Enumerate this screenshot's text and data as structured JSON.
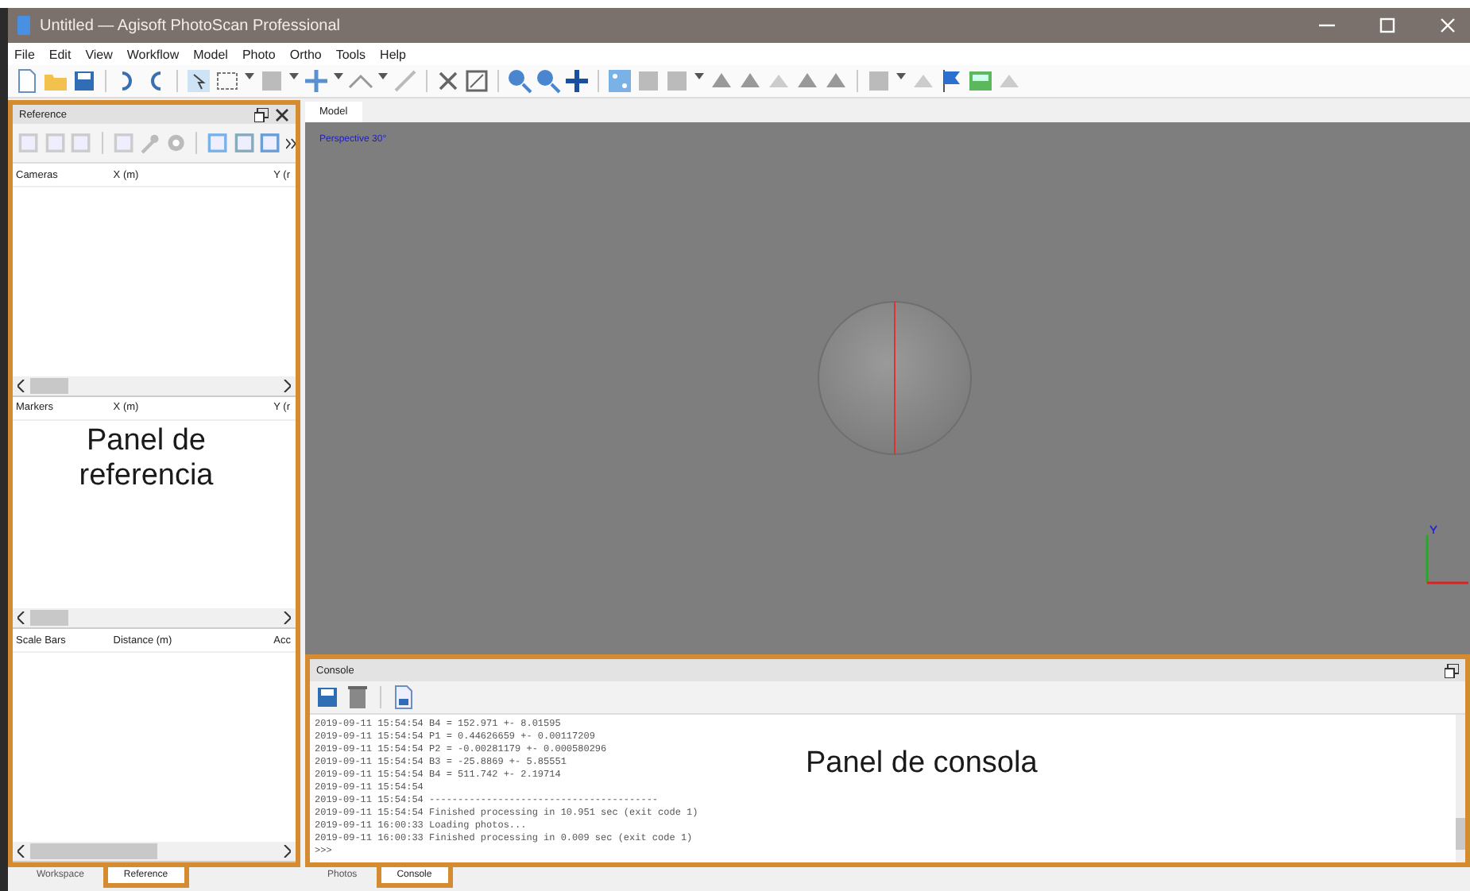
{
  "window": {
    "title": "Untitled — Agisoft PhotoScan Professional"
  },
  "menu": [
    "File",
    "Edit",
    "View",
    "Workflow",
    "Model",
    "Photo",
    "Ortho",
    "Tools",
    "Help"
  ],
  "reference_panel": {
    "title": "Reference",
    "sections": [
      {
        "columns": [
          "Cameras",
          "X (m)",
          "Y (r"
        ]
      },
      {
        "columns": [
          "Markers",
          "X (m)",
          "Y (r"
        ]
      },
      {
        "columns": [
          "Scale Bars",
          "Distance (m)",
          "Acc"
        ]
      }
    ]
  },
  "left_tabs": [
    {
      "label": "Workspace",
      "selected": false
    },
    {
      "label": "Reference",
      "selected": true
    }
  ],
  "viewport": {
    "tab": "Model",
    "label": "Perspective 30°"
  },
  "console": {
    "title": "Console",
    "lines": [
      "2019-09-11 15:54:54 B4 = 152.971 +- 8.01595",
      "2019-09-11 15:54:54 P1 = 0.44626659 +- 0.00117209",
      "2019-09-11 15:54:54 P2 = -0.00281179 +- 0.000580296",
      "2019-09-11 15:54:54 B3 = -25.8869 +- 5.85551",
      "2019-09-11 15:54:54 B4 = 511.742 +- 2.19714",
      "2019-09-11 15:54:54",
      "2019-09-11 15:54:54 ----------------------------------------",
      "2019-09-11 15:54:54 Finished processing in 10.951 sec (exit code 1)",
      "2019-09-11 16:00:33 Loading photos...",
      "2019-09-11 16:00:33 Finished processing in 0.009 sec (exit code 1)",
      ">>>"
    ]
  },
  "bottom_tabs": [
    {
      "label": "Photos",
      "selected": false
    },
    {
      "label": "Console",
      "selected": true
    }
  ],
  "annotations": [
    {
      "kind": "reference",
      "text": "Panel de referencia"
    },
    {
      "kind": "console",
      "text": "Panel de consola"
    }
  ]
}
